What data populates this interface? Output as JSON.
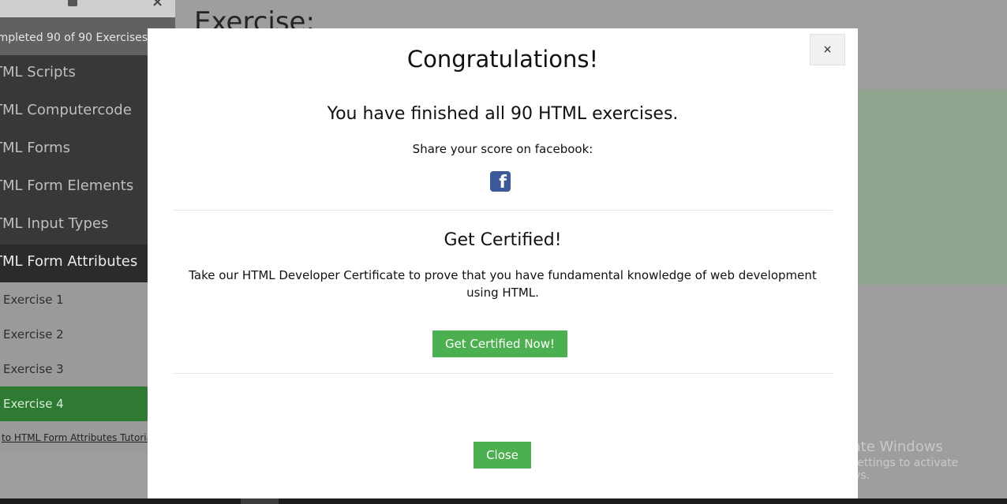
{
  "background": {
    "sidebar": {
      "progress_text": "ompleted 90 of 90 Exercises:",
      "categories": [
        {
          "label": "TML Scripts"
        },
        {
          "label": "TML Computercode"
        },
        {
          "label": "TML Forms"
        },
        {
          "label": "TML Form Elements"
        },
        {
          "label": "TML Input Types"
        },
        {
          "label": "TML Form Attributes"
        }
      ],
      "exercises": [
        {
          "label": "Exercise 1"
        },
        {
          "label": "Exercise 2"
        },
        {
          "label": "Exercise 3"
        },
        {
          "label": "Exercise 4"
        }
      ],
      "back_link": "to HTML Form Attributes Tutorial"
    },
    "main_title": "Exercise:",
    "watermark": {
      "line1": "Activate Windows",
      "line2": "Go to Settings to activate Windows."
    }
  },
  "modal": {
    "close_x": "×",
    "title": "Congratulations!",
    "finished_text": "You have finished all 90 HTML exercises.",
    "share_text": "Share your score on facebook:",
    "fb_icon": "facebook-icon",
    "cert_title": "Get Certified!",
    "cert_text": "Take our HTML Developer Certificate to prove that you have fundamental knowledge of web development using HTML.",
    "cert_button": "Get Certified Now!",
    "close_button": "Close"
  },
  "colors": {
    "accent_green": "#4caf50",
    "facebook_blue": "#3b5998"
  }
}
